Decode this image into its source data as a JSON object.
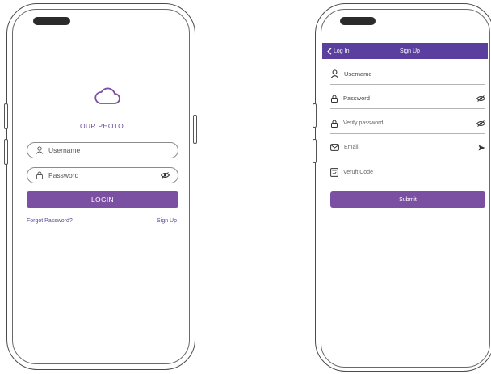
{
  "login_screen": {
    "brand_name": "OUR PHOTO",
    "brand_icon": "cloud-icon",
    "username_placeholder": "Username",
    "password_placeholder": "Password",
    "login_label": "LOGIN",
    "forgot_password_label": "Forgot Password?",
    "signup_link_label": "Sign Up"
  },
  "signup_screen": {
    "header": {
      "back_label": "Log In",
      "title": "Sign Up"
    },
    "fields": {
      "username": "Username",
      "password": "Password",
      "verify_password": "Verify password",
      "email": "Email",
      "verify_code": "Veruft Code"
    },
    "submit_label": "Submit"
  },
  "colors": {
    "accent": "#7b4fa2",
    "header": "#5a3f9e",
    "outline": "#4a4a4a"
  }
}
